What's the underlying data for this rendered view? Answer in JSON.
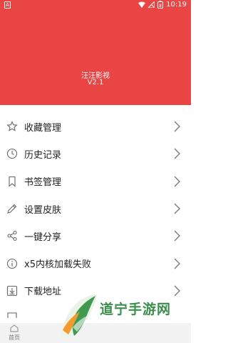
{
  "status_bar": {
    "time": "10:19",
    "battery": "8"
  },
  "app": {
    "name": "汪汪影视",
    "version": "V2.1"
  },
  "menu": [
    {
      "label": "收藏管理",
      "icon": "star-icon"
    },
    {
      "label": "历史记录",
      "icon": "clock-icon"
    },
    {
      "label": "书签管理",
      "icon": "bookmark-icon"
    },
    {
      "label": "设置皮肤",
      "icon": "pencil-icon"
    },
    {
      "label": "一键分享",
      "icon": "share-icon"
    },
    {
      "label": "x5内核加载失败",
      "icon": "info-icon"
    },
    {
      "label": "下载地址",
      "icon": "download-icon"
    }
  ],
  "bottom_nav": {
    "home_label": "首页"
  },
  "watermark": {
    "text": "道宁手游网"
  },
  "colors": {
    "primary": "#e94545",
    "watermark": "#3a8f4b"
  }
}
